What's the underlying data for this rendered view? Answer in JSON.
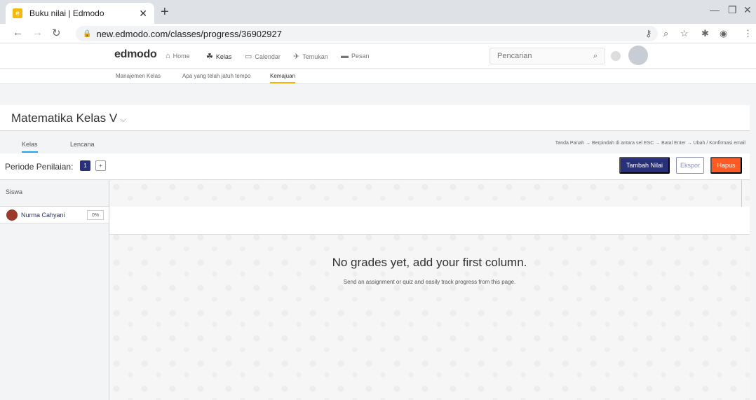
{
  "browser": {
    "tab_title": "Buku nilai | Edmodo",
    "favicon_letter": "e",
    "url": "new.edmodo.com/classes/progress/36902927"
  },
  "header": {
    "logo": "edmodo",
    "nav": [
      {
        "label": "Home",
        "icon": "home-icon"
      },
      {
        "label": "Kelas",
        "icon": "classes-icon"
      },
      {
        "label": "Calendar",
        "icon": "calendar-icon"
      },
      {
        "label": "Temukan",
        "icon": "discover-icon"
      },
      {
        "label": "Pesan",
        "icon": "message-icon"
      }
    ],
    "search_placeholder": "Pencarian"
  },
  "subnav": {
    "items": [
      "Manajemen Kelas",
      "Apa yang telah jatuh tempo",
      "Kemajuan"
    ],
    "active": "Kemajuan"
  },
  "class": {
    "title": "Matematika Kelas V"
  },
  "gradebook_tabs": {
    "items": [
      "Kelas",
      "Lencana"
    ],
    "active": "Kelas",
    "shortcut_hint": "Tanda Panah → Berpindah di antara sel   ESC → Batal   Enter → Ubah / Konfirmasi email"
  },
  "toolbar": {
    "period_label": "Periode Penilaian:",
    "period_selected": "1",
    "period_add": "+",
    "add_grade_label": "Tambah Nilai",
    "export_label": "Ekspor",
    "delete_label": "Hapus"
  },
  "students": {
    "header": "Siswa",
    "rows": [
      {
        "name": "Nurma Cahyani",
        "percent": "0%"
      }
    ]
  },
  "empty_state": {
    "title": "No grades yet, add your first column.",
    "subtitle": "Send an assignment or quiz and easily track progress from this page."
  },
  "colors": {
    "primary": "#28307a",
    "danger": "#ff5a21",
    "tab_active": "#23a4e8",
    "subnav_active": "#f5b400"
  }
}
